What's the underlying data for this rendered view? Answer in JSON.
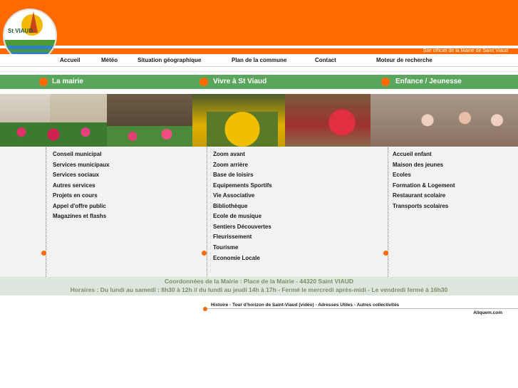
{
  "header": {
    "logo_text": "St VIAUD",
    "official_text": "Site officiel de la Mairie de Saint Viaud"
  },
  "menu": [
    {
      "label": "Accueil"
    },
    {
      "label": "Météo"
    },
    {
      "label": "Situation géographique"
    },
    {
      "label": "Plan de la commune"
    },
    {
      "label": "Contact"
    },
    {
      "label": "Moteur de recherche"
    }
  ],
  "sections": [
    {
      "label": "La mairie"
    },
    {
      "label": "Vivre à St Viaud"
    },
    {
      "label": "Enfance / Jeunesse"
    }
  ],
  "columns": {
    "mairie": [
      "Conseil municipal",
      "Services municipaux",
      "Services sociaux",
      "Autres services",
      "Projets en cours",
      "Appel d'offre public",
      "Magazines et flashs"
    ],
    "vivre": [
      "Zoom avant",
      "Zoom arrière",
      "Base de loisirs",
      "Equipements Sportifs",
      "Vie Associative",
      "Bibliothèque",
      "Ecole de musique",
      "Sentiers Découvertes",
      "Fleurissement",
      "Tourisme",
      "Economie Locale"
    ],
    "enfance": [
      "Accueil enfant",
      "Maison des jeunes",
      "Ecoles",
      "Formation & Logement",
      "Restaurant scolaire",
      "Transports scolaires"
    ]
  },
  "contact": {
    "line1": "Coordonnées de la Mairie : Place de la Mairie - 44320 Saint VIAUD",
    "line2": "Horaires : Du lundi au samedi : 8h30 à 12h // du lundi au jeudi 14h à 17h - Fermé le mercredi après-midi - Le vendredi fermé à 16h30"
  },
  "footer": {
    "links": [
      "Histoire",
      "Tour d'horizon de Saint-Viaud (vidéo)",
      "Adresses Utiles",
      "Autres collectivités"
    ],
    "separator": " - ",
    "credit": "Aliquem.com"
  },
  "colors": {
    "brand_orange": "#ff6a00",
    "section_green": "#5aa65c",
    "contact_text": "#7c8f6c"
  }
}
